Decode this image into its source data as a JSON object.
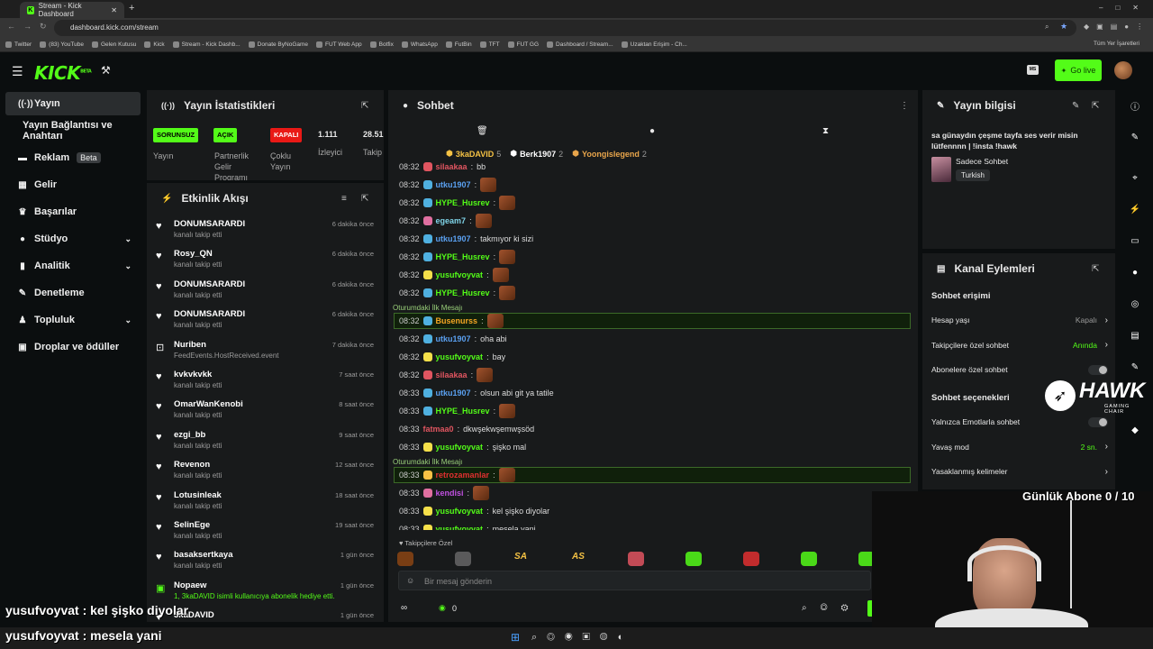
{
  "browser": {
    "tabs": [
      {
        "label": "Stream - Kick Dashboard",
        "active": true
      }
    ],
    "url": "dashboard.kick.com/stream",
    "bookmarks": [
      "Twitter",
      "(83) YouTube",
      "Gelen Kutusu",
      "Kick",
      "Stream - Kick Dashb...",
      "Donate ByNoGame",
      "FUT Web App",
      "Botfix",
      "WhatsApp",
      "FutBin",
      "TFT",
      "FUT GG",
      "Dashboard / Stream...",
      "Uzaktan Erişim - Ch..."
    ],
    "all_bookmarks": "Tüm Yer İşaretleri"
  },
  "header": {
    "logo": "KICK",
    "logo_sup": "BETA",
    "go_live": "Go live",
    "accent": "#53fc18"
  },
  "sidebar": {
    "items": [
      {
        "label": "Yayın",
        "icon": "broadcast-icon",
        "glyph": "((·))"
      },
      {
        "label": "Yayın Bağlantısı ve Anahtarı",
        "icon": "",
        "glyph": ""
      },
      {
        "label": "Reklam",
        "icon": "ad-icon",
        "glyph": "▬",
        "badge": "Beta"
      },
      {
        "label": "Gelir",
        "icon": "revenue-icon",
        "glyph": "▦"
      },
      {
        "label": "Başarılar",
        "icon": "trophy-icon",
        "glyph": "♛"
      },
      {
        "label": "Stüdyo",
        "icon": "studio-icon",
        "glyph": "●",
        "chevron": true
      },
      {
        "label": "Analitik",
        "icon": "analytics-icon",
        "glyph": "▮",
        "chevron": true
      },
      {
        "label": "Denetleme",
        "icon": "moderation-icon",
        "glyph": "✎"
      },
      {
        "label": "Topluluk",
        "icon": "community-icon",
        "glyph": "♟",
        "chevron": true
      },
      {
        "label": "Droplar ve ödüller",
        "icon": "drops-icon",
        "glyph": "▣"
      }
    ]
  },
  "stats": {
    "title": "Yayın İstatistikleri",
    "badges": [
      {
        "label": "SORUNSUZ",
        "sub": "Yayın",
        "color": "#53fc18"
      },
      {
        "label": "AÇIK",
        "sub": "Partnerlik Gelir Programı",
        "color": "#53fc18"
      },
      {
        "label": "KAPALI",
        "sub": "Çoklu Yayın",
        "color": "#e91916"
      }
    ],
    "viewers": "1.111",
    "viewers_label": "İzleyici",
    "followers": "28.51",
    "followers_label": "Takip"
  },
  "feed": {
    "title": "Etkinlik Akışı",
    "items": [
      {
        "name": "DONUMSARARDI",
        "sub": "kanalı takip etti",
        "time": "6 dakika önce"
      },
      {
        "name": "Rosy_QN",
        "sub": "kanalı takip etti",
        "time": "6 dakika önce"
      },
      {
        "name": "DONUMSARARDI",
        "sub": "kanalı takip etti",
        "time": "6 dakika önce"
      },
      {
        "name": "DONUMSARARDI",
        "sub": "kanalı takip etti",
        "time": "6 dakika önce"
      },
      {
        "name": "Nuriben",
        "sub": "FeedEvents.HostReceived.event",
        "time": "7 dakika önce"
      },
      {
        "name": "kvkvkvkk",
        "sub": "kanalı takip etti",
        "time": "7 saat önce"
      },
      {
        "name": "OmarWanKenobi",
        "sub": "kanalı takip etti",
        "time": "8 saat önce"
      },
      {
        "name": "ezgi_bb",
        "sub": "kanalı takip etti",
        "time": "9 saat önce"
      },
      {
        "name": "Revenon",
        "sub": "kanalı takip etti",
        "time": "12 saat önce"
      },
      {
        "name": "Lotusinleak",
        "sub": "kanalı takip etti",
        "time": "18 saat önce"
      },
      {
        "name": "SelinEge",
        "sub": "kanalı takip etti",
        "time": "19 saat önce"
      },
      {
        "name": "basaksertkaya",
        "sub": "kanalı takip etti",
        "time": "1 gün önce"
      },
      {
        "name": "Nopaew",
        "sub": "1, 3kaDAVID isimli kullanıcıya abonelik hediye etti.",
        "time": "1 gün önce"
      },
      {
        "name": "3kaDAVID",
        "sub": "",
        "time": "1 gün önce"
      }
    ]
  },
  "chat": {
    "title": "Sohbet",
    "top_gifters": [
      {
        "name": "3kaDAVID",
        "count": "5",
        "color": "#f5c244"
      },
      {
        "name": "Berk1907",
        "count": "2",
        "color": "#ffffff"
      },
      {
        "name": "Yoongislegend",
        "count": "2",
        "color": "#e8a54b"
      }
    ],
    "first_message_label": "Oturumdaki İlk Mesajı",
    "messages": [
      {
        "time": "08:32",
        "user": "silaakaa",
        "color": "#e05560",
        "text": "bb",
        "badge": "#e05560"
      },
      {
        "time": "08:32",
        "user": "utku1907",
        "color": "#5aa0f0",
        "text": "",
        "badge": "#4fb0e0",
        "emote": true
      },
      {
        "time": "08:32",
        "user": "HYPE_Husrev",
        "color": "#53fc18",
        "text": "",
        "badge": "#4fb0e0",
        "emote": true
      },
      {
        "time": "08:32",
        "user": "egeam7",
        "color": "#7fd4e8",
        "text": "",
        "badge": "#e06fa0",
        "emote": true
      },
      {
        "time": "08:32",
        "user": "utku1907",
        "color": "#5aa0f0",
        "text": "takmıyor ki sizi",
        "badge": "#4fb0e0"
      },
      {
        "time": "08:32",
        "user": "HYPE_Husrev",
        "color": "#53fc18",
        "text": "",
        "badge": "#4fb0e0",
        "emote": true
      },
      {
        "time": "08:32",
        "user": "yusufvoyvat",
        "color": "#53fc18",
        "text": "",
        "badge": "#f5e04a",
        "emote": true
      },
      {
        "time": "08:32",
        "user": "HYPE_Husrev",
        "color": "#53fc18",
        "text": "",
        "badge": "#4fb0e0",
        "emote": true
      },
      {
        "time": "08:32",
        "user": "Busenurss",
        "color": "#f5a623",
        "text": "",
        "badge": "#4fb0e0",
        "emote": true,
        "first": true
      },
      {
        "time": "08:32",
        "user": "utku1907",
        "color": "#5aa0f0",
        "text": "oha abi",
        "badge": "#4fb0e0"
      },
      {
        "time": "08:32",
        "user": "yusufvoyvat",
        "color": "#53fc18",
        "text": "bay",
        "badge": "#f5e04a"
      },
      {
        "time": "08:32",
        "user": "silaakaa",
        "color": "#e05560",
        "text": "",
        "badge": "#e05560",
        "emote": true
      },
      {
        "time": "08:33",
        "user": "utku1907",
        "color": "#5aa0f0",
        "text": "olsun abi git ya tatile",
        "badge": "#4fb0e0"
      },
      {
        "time": "08:33",
        "user": "HYPE_Husrev",
        "color": "#53fc18",
        "text": "",
        "badge": "#4fb0e0",
        "emote": true
      },
      {
        "time": "08:33",
        "user": "fatmaa0",
        "color": "#e05560",
        "text": "dkwşekwşemwşsöd",
        "badge": ""
      },
      {
        "time": "08:33",
        "user": "yusufvoyvat",
        "color": "#53fc18",
        "text": "şişko mal",
        "badge": "#f5e04a"
      },
      {
        "time": "08:33",
        "user": "retrozamanlar",
        "color": "#e03030",
        "text": "",
        "badge": "#f5c244",
        "emote": true,
        "first": true
      },
      {
        "time": "08:33",
        "user": "kendisi",
        "color": "#c050e0",
        "text": "",
        "badge": "#e06fa0",
        "emote": true
      },
      {
        "time": "08:33",
        "user": "yusufvoyvat",
        "color": "#53fc18",
        "text": "kel şişko diyolar",
        "badge": "#f5e04a"
      },
      {
        "time": "08:33",
        "user": "yusufvoyvat",
        "color": "#53fc18",
        "text": "mesela yani",
        "badge": "#f5e04a"
      }
    ],
    "follower_only_label": "Takipçilere Özel",
    "emote_bar": [
      "",
      "",
      "SA",
      "AS",
      "",
      "",
      "",
      "",
      ""
    ],
    "input_placeholder": "Bir mesaj gönderin",
    "points": "0"
  },
  "stream_info": {
    "title": "Yayın bilgisi",
    "stream_title": "sa günaydın çeşme tayfa ses verir misin lütfennnn | !insta !hawk",
    "category": "Sadece Sohbet",
    "language": "Turkish"
  },
  "channel_actions": {
    "title": "Kanal Eylemleri",
    "access_heading": "Sohbet erişimi",
    "access_rows": [
      {
        "label": "Hesap yaşı",
        "value": "Kapalı",
        "value_color": "#9a9a9a",
        "type": "arrow"
      },
      {
        "label": "Takipçilere özel sohbet",
        "value": "Anında",
        "value_color": "#53fc18",
        "type": "arrow"
      },
      {
        "label": "Abonelere özel sohbet",
        "value": "",
        "type": "toggle"
      }
    ],
    "options_heading": "Sohbet seçenekleri",
    "option_rows": [
      {
        "label": "Yalnızca Emotlarla sohbet",
        "value": "",
        "type": "toggle"
      },
      {
        "label": "Yavaş mod",
        "value": "2 sn.",
        "value_color": "#53fc18",
        "type": "arrow"
      },
      {
        "label": "Yasaklanmış kelimeler",
        "value": "",
        "type": "arrow"
      }
    ]
  },
  "overlay": {
    "sponsor": "HAWK",
    "sponsor_sub": "GAMING CHAIR",
    "sub_goal": "Günlük Abone 0 / 10",
    "captions": [
      {
        "user": "yusufvoyvat",
        "text": ": kel şişko diyolar"
      },
      {
        "user": "yusufvoyvat",
        "text": ": mesela yani"
      }
    ]
  }
}
